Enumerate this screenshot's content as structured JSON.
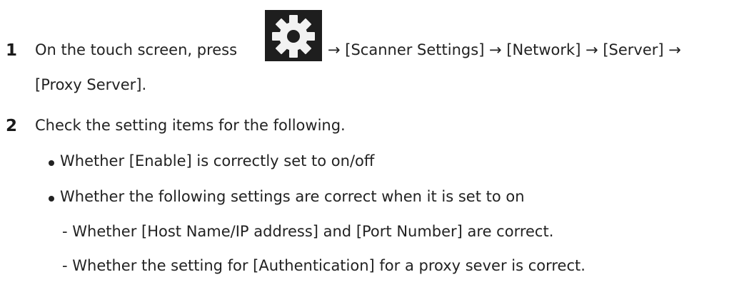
{
  "step1": {
    "number": "1",
    "text_before_icon": "On the touch screen, press",
    "icon": "gear-icon",
    "text_after_icon": "→ [Scanner Settings] → [Network] → [Server] →",
    "text_line2": "[Proxy Server]."
  },
  "step2": {
    "number": "2",
    "text": "Check the setting items for the following.",
    "bullets": [
      "Whether [Enable] is correctly set to on/off",
      "Whether the following settings are correct when it is set to on"
    ],
    "sub_items": [
      "- Whether [Host Name/IP address] and [Port Number] are correct.",
      "- Whether the setting for [Authentication] for a proxy sever is correct."
    ]
  }
}
